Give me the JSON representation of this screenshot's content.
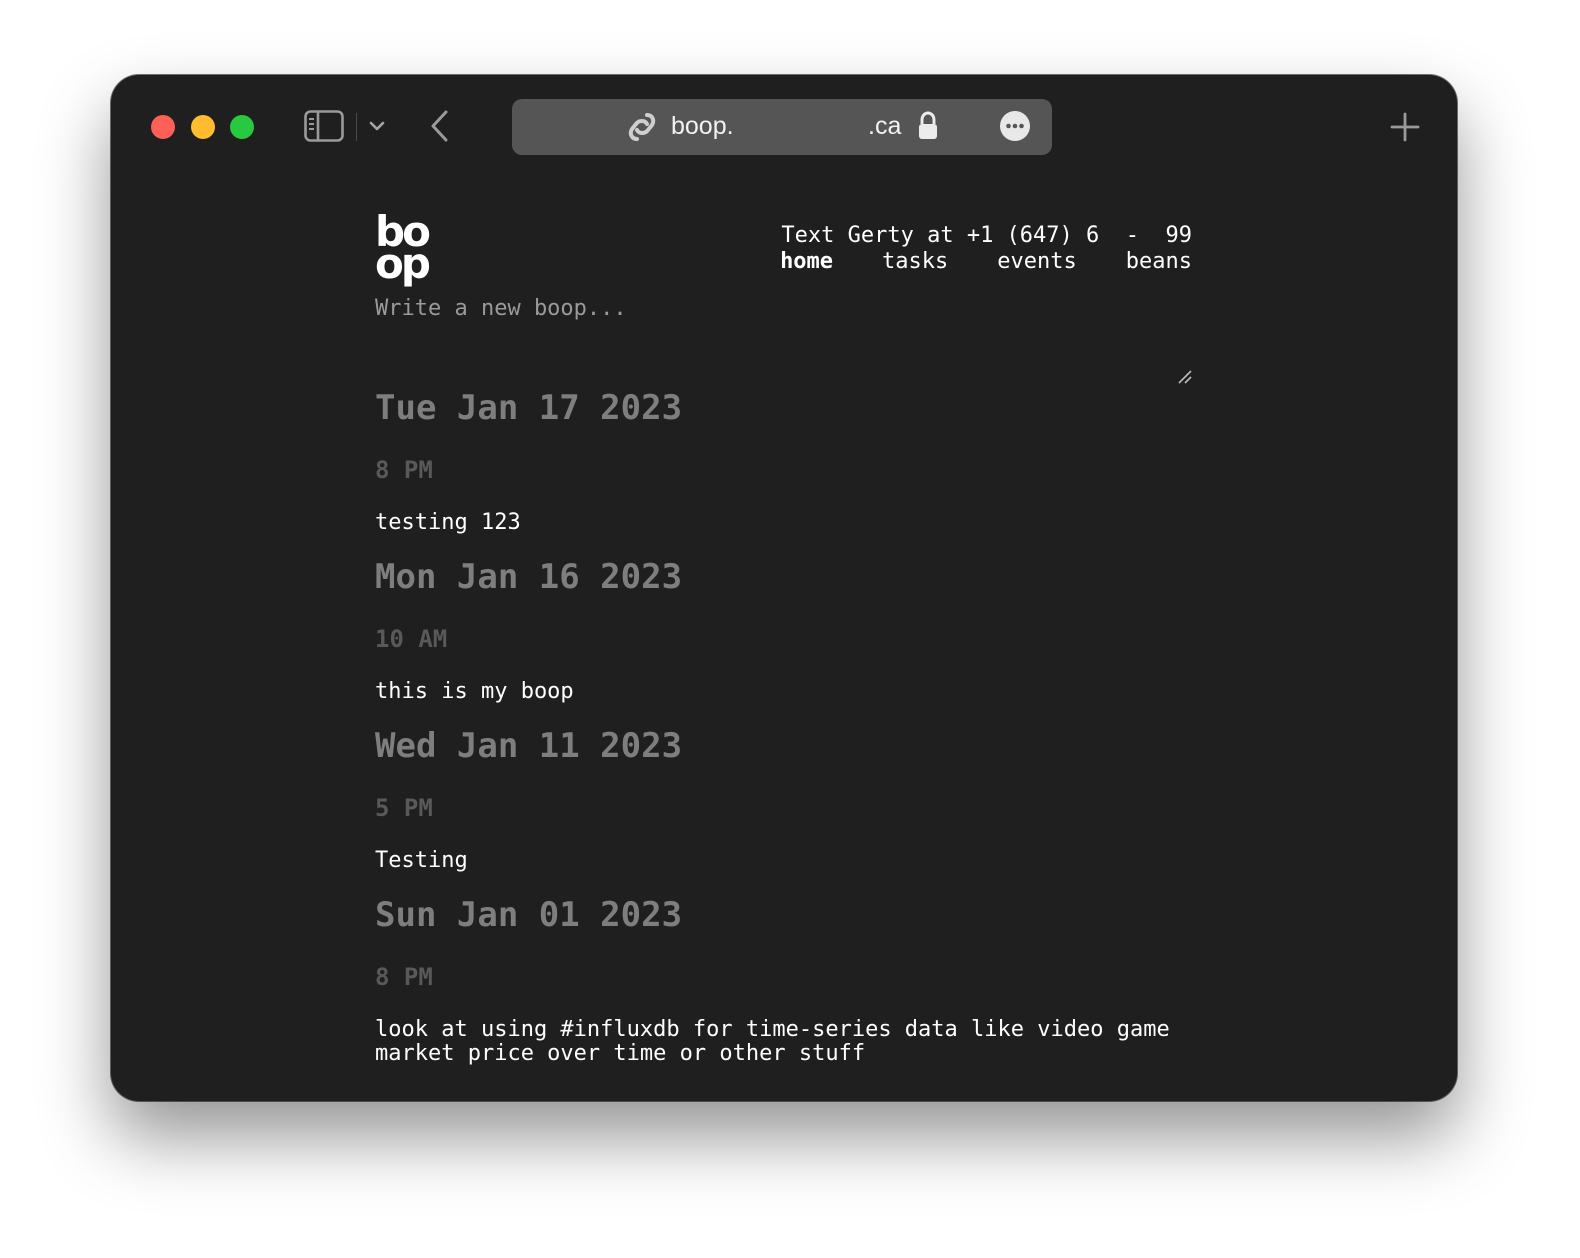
{
  "browser": {
    "url_left": "boop.",
    "url_right": ".ca",
    "icons": {
      "sidebar": "sidebar-icon",
      "chevron": "chevron-down-icon",
      "back": "back-arrow-icon",
      "site": "svelte-icon",
      "lock": "lock-icon",
      "more": "more-icon",
      "new_tab": "plus-icon"
    },
    "colors": {
      "close": "#fe5f57",
      "minimize": "#febc2e",
      "zoom": "#28c840",
      "urlbar": "#555555",
      "page_bg": "#1f1f1f"
    }
  },
  "header": {
    "logo_line1": "bo",
    "logo_line2": "op",
    "text_line": "Text Gerty at +1 (647) 6  -  99",
    "nav": [
      {
        "label": "home"
      },
      {
        "label": "tasks"
      },
      {
        "label": "events"
      },
      {
        "label": "beans"
      }
    ]
  },
  "compose": {
    "placeholder": "Write a new boop..."
  },
  "entries": [
    {
      "date": "Tue Jan 17 2023",
      "time": "8 PM",
      "text": "testing 123"
    },
    {
      "date": "Mon Jan 16 2023",
      "time": "10 AM",
      "text": "this is my boop"
    },
    {
      "date": "Wed Jan 11 2023",
      "time": "5 PM",
      "text": "Testing"
    },
    {
      "date": "Sun Jan 01 2023",
      "time": "8 PM",
      "text": "look at using #influxdb for time-series data like video game market price over time or other stuff"
    }
  ]
}
